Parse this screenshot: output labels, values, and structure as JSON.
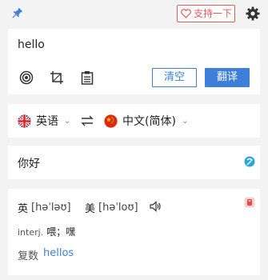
{
  "toolbar": {
    "support_label": "支持一下",
    "pin_icon": "pin-icon",
    "settings_icon": "gear-icon"
  },
  "input": {
    "text": "hello",
    "clear_label": "清空",
    "translate_label": "翻译",
    "accent": "#3d7fd9"
  },
  "languages": {
    "source": "英语",
    "target": "中文(简体)"
  },
  "result": {
    "text": "你好"
  },
  "dictionary": {
    "uk_label": "英",
    "uk_ipa": "[həˈləʊ]",
    "us_label": "美",
    "us_ipa": "[həˈloʊ]",
    "pos": "interj.",
    "meaning": "喂；嘿",
    "plural_label": "复数",
    "plural_word": "hellos"
  }
}
